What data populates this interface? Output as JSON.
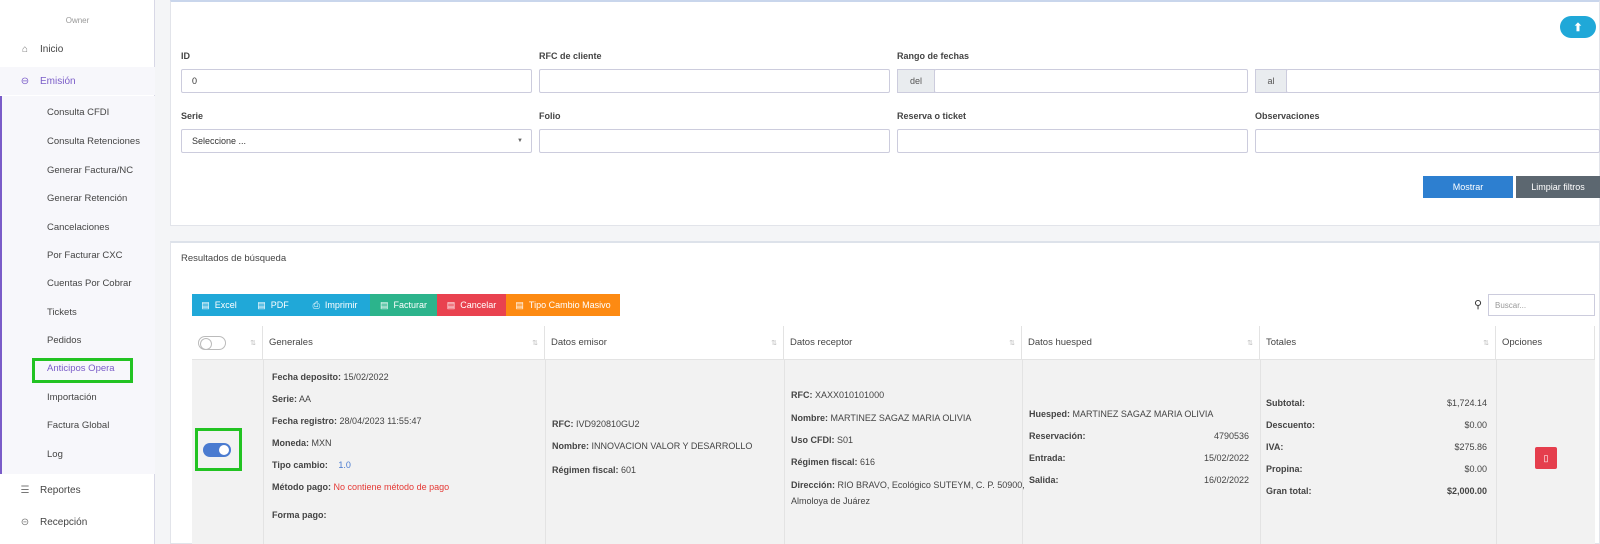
{
  "sidebar": {
    "role": "Owner",
    "items": [
      {
        "label": "Inicio",
        "icon": "home-icon"
      },
      {
        "label": "Emisión",
        "icon": "arrow-circle-icon"
      },
      {
        "label": "Reportes",
        "icon": "list-icon"
      },
      {
        "label": "Recepción",
        "icon": "arrow-left-circle-icon"
      }
    ],
    "submenu": [
      "Consulta CFDI",
      "Consulta Retenciones",
      "Generar Factura/NC",
      "Generar Retención",
      "Cancelaciones",
      "Por Facturar CXC",
      "Cuentas Por Cobrar",
      "Tickets",
      "Pedidos",
      "Anticipos Opera",
      "Importación",
      "Factura Global",
      "Log"
    ]
  },
  "filters": {
    "id_label": "ID",
    "id_value": "0",
    "rfc_label": "RFC de cliente",
    "rfc_value": "",
    "date_range_label": "Rango de fechas",
    "from_addon": "del",
    "to_addon": "al",
    "serie_label": "Serie",
    "serie_value": "Seleccione ...",
    "folio_label": "Folio",
    "reserva_label": "Reserva o ticket",
    "obs_label": "Observaciones",
    "show_button": "Mostrar",
    "clear_button": "Limpiar filtros"
  },
  "results": {
    "title": "Resultados de búsqueda",
    "toolbar": [
      {
        "label": "Excel",
        "color": "#20a8d8"
      },
      {
        "label": "PDF",
        "color": "#20a8d8"
      },
      {
        "label": "Imprimir",
        "color": "#20a8d8"
      },
      {
        "label": "Facturar",
        "color": "#2cb48c"
      },
      {
        "label": "Cancelar",
        "color": "#e9424f"
      },
      {
        "label": "Tipo Cambio Masivo",
        "color": "#fd8a12"
      }
    ],
    "search_placeholder": "Buscar...",
    "columns": [
      "Generales",
      "Datos emisor",
      "Datos receptor",
      "Datos huesped",
      "Totales",
      "Opciones"
    ],
    "row": {
      "generales": {
        "fecha_deposito_label": "Fecha deposito:",
        "fecha_deposito": "15/02/2022",
        "serie_label": "Serie:",
        "serie": "AA",
        "fecha_registro_label": "Fecha registro:",
        "fecha_registro": "28/04/2023 11:55:47",
        "moneda_label": "Moneda:",
        "moneda": "MXN",
        "tipo_cambio_label": "Tipo cambio:",
        "tipo_cambio": "1.0",
        "metodo_pago_label": "Método pago:",
        "metodo_pago": "No contiene método de pago",
        "forma_pago_label": "Forma pago:"
      },
      "emisor": {
        "rfc_label": "RFC:",
        "rfc": "IVD920810GU2",
        "nombre_label": "Nombre:",
        "nombre": "INNOVACION VALOR Y DESARROLLO",
        "regimen_label": "Régimen fiscal:",
        "regimen": "601"
      },
      "receptor": {
        "rfc_label": "RFC:",
        "rfc": "XAXX010101000",
        "nombre_label": "Nombre:",
        "nombre": "MARTINEZ SAGAZ MARIA OLIVIA",
        "uso_label": "Uso CFDI:",
        "uso": "S01",
        "regimen_label": "Régimen fiscal:",
        "regimen": "616",
        "direccion_label": "Dirección:",
        "direccion_1": "RIO BRAVO, Ecológico SUTEYM, C. P. 50900,",
        "direccion_2": "Almoloya de Juárez"
      },
      "huesped": {
        "huesped_label": "Huesped:",
        "huesped": "MARTINEZ SAGAZ MARIA OLIVIA",
        "reservacion_label": "Reservación:",
        "reservacion": "4790536",
        "entrada_label": "Entrada:",
        "entrada": "15/02/2022",
        "salida_label": "Salida:",
        "salida": "16/02/2022"
      },
      "totales": {
        "subtotal_label": "Subtotal:",
        "subtotal": "$1,724.14",
        "descuento_label": "Descuento:",
        "descuento": "$0.00",
        "iva_label": "IVA:",
        "iva": "$275.86",
        "propina_label": "Propina:",
        "propina": "$0.00",
        "gran_total_label": "Gran total:",
        "gran_total": "$2,000.00"
      }
    }
  }
}
